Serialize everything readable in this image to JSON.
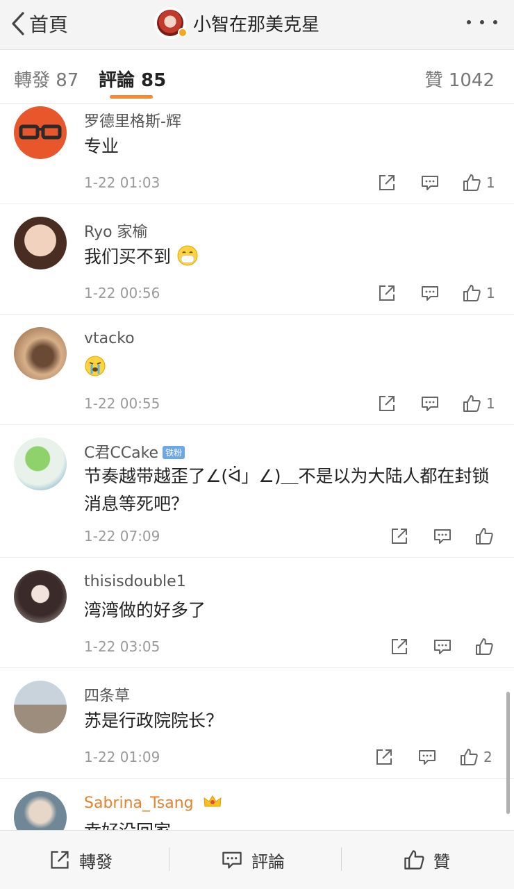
{
  "header": {
    "back_label": "首頁",
    "title": "小智在那美克星"
  },
  "tabs": {
    "repost": "轉發 87",
    "comment": "評論 85",
    "like": "贊 1042"
  },
  "comments": [
    {
      "user": "罗德里格斯-辉",
      "text": "专业",
      "time": "1-22 01:03",
      "likes": "1"
    },
    {
      "user": "Ryo 家榆",
      "text": "我们买不到",
      "emoji": "mask-emoji",
      "time": "1-22 00:56",
      "likes": "1"
    },
    {
      "user": "vtacko",
      "text": "",
      "emoji": "crying-emoji",
      "time": "1-22 00:55",
      "likes": "1"
    },
    {
      "user": "C君CCake",
      "badge": "铁粉",
      "text": "节奏越带越歪了∠(ᐛ」∠)＿不是以为大陆人都在封锁消息等死吧？",
      "time": "1-22 07:09",
      "likes": ""
    },
    {
      "user": "thisisdouble1",
      "text": "湾湾做的好多了",
      "time": "1-22 03:05",
      "likes": ""
    },
    {
      "user": "四条草",
      "text": "苏是行政院院长？",
      "time": "1-22 01:09",
      "likes": "2"
    },
    {
      "user": "Sabrina_Tsang",
      "user_color": "#e5822b",
      "text": "幸好没回家",
      "icon": "crown-icon"
    }
  ],
  "bottom_bar": {
    "repost": "轉發",
    "comment": "評論",
    "like": "贊"
  },
  "colors": {
    "accent": "#f78a2e",
    "vip_name": "#e5822b"
  }
}
